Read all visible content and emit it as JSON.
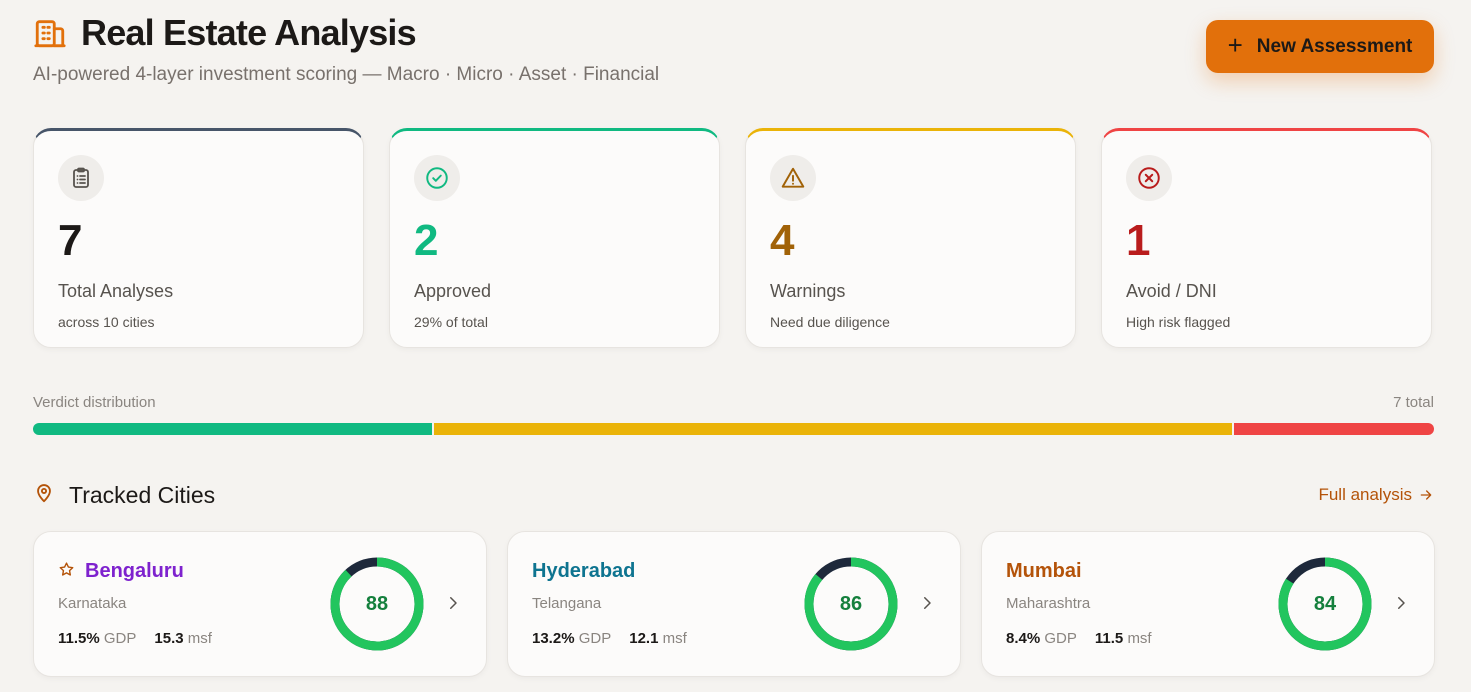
{
  "header": {
    "title": "Real Estate Analysis",
    "subtitle": "AI-powered 4-layer investment scoring — Macro · Micro · Asset · Financial",
    "title_icon": "building-icon",
    "new_button_label": "New Assessment",
    "accent_color": "#e2700b"
  },
  "stats": [
    {
      "value": "7",
      "label": "Total Analyses",
      "sub": "across 10 cities",
      "icon": "clipboard-icon",
      "color": "#1c1917"
    },
    {
      "value": "2",
      "label": "Approved",
      "sub": "29% of total",
      "icon": "check-circle-icon",
      "color": "#10b981"
    },
    {
      "value": "4",
      "label": "Warnings",
      "sub": "Need due diligence",
      "icon": "warning-icon",
      "color": "#a16207"
    },
    {
      "value": "1",
      "label": "Avoid / DNI",
      "sub": "High risk flagged",
      "icon": "x-circle-icon",
      "color": "#b91c1c"
    }
  ],
  "distribution": {
    "label": "Verdict distribution",
    "total_label": "7 total",
    "segments": [
      {
        "verdict": "Approved",
        "count": 2,
        "color": "#10b981"
      },
      {
        "verdict": "Warnings",
        "count": 4,
        "color": "#eab308"
      },
      {
        "verdict": "Avoid / DNI",
        "count": 1,
        "color": "#ef4444"
      }
    ]
  },
  "cities_section": {
    "title": "Tracked Cities",
    "link_label": "Full analysis",
    "icon": "map-pin-icon"
  },
  "cities": [
    {
      "name": "Bengaluru",
      "state": "Karnataka",
      "gdp": "11.5%",
      "gdp_label": "GDP",
      "msf": "15.3",
      "msf_label": "msf",
      "score": "88",
      "score_fraction": 0.88,
      "name_color": "#7e22ce",
      "starred": true
    },
    {
      "name": "Hyderabad",
      "state": "Telangana",
      "gdp": "13.2%",
      "gdp_label": "GDP",
      "msf": "12.1",
      "msf_label": "msf",
      "score": "86",
      "score_fraction": 0.86,
      "name_color": "#0e7490",
      "starred": false
    },
    {
      "name": "Mumbai",
      "state": "Maharashtra",
      "gdp": "8.4%",
      "gdp_label": "GDP",
      "msf": "11.5",
      "msf_label": "msf",
      "score": "84",
      "score_fraction": 0.84,
      "name_color": "#b45309",
      "starred": false
    }
  ]
}
